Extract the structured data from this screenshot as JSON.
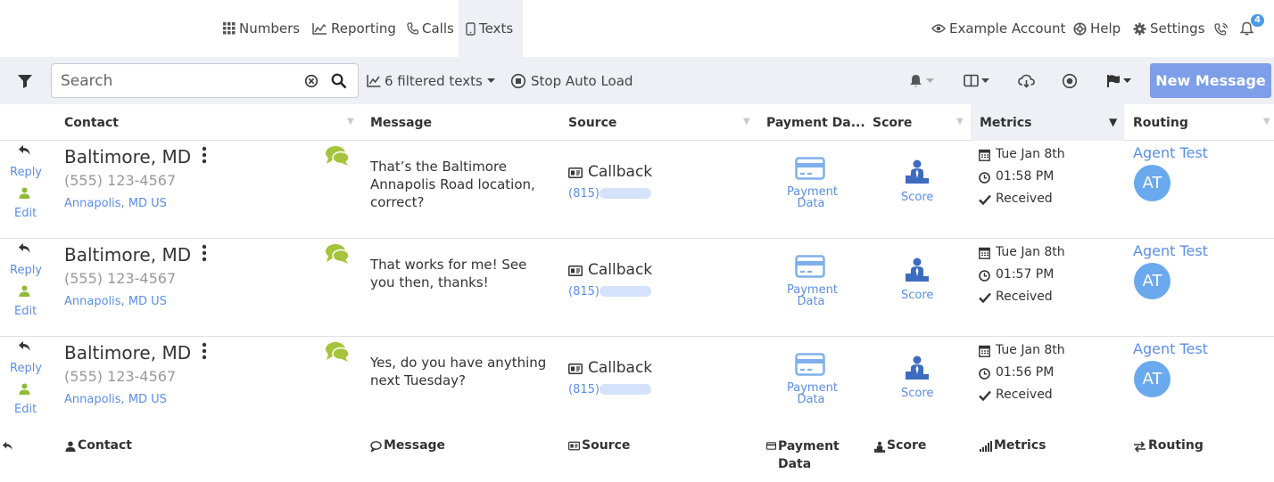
{
  "nav": {
    "items": [
      {
        "label": "Numbers",
        "icon": "grid-icon"
      },
      {
        "label": "Reporting",
        "icon": "chart-icon"
      },
      {
        "label": "Calls",
        "icon": "phone-icon"
      },
      {
        "label": "Texts",
        "icon": "mobile-icon",
        "active": true
      }
    ],
    "right": {
      "account": "Example Account",
      "help": "Help",
      "settings": "Settings",
      "notification_count": "4"
    }
  },
  "toolbar": {
    "search_placeholder": "Search",
    "filtered": "6 filtered texts",
    "stop_auto_load": "Stop Auto Load",
    "new_message": "New Message"
  },
  "columns": {
    "contact": "Contact",
    "message": "Message",
    "source": "Source",
    "payment": "Payment Da...",
    "score": "Score",
    "metrics": "Metrics",
    "routing": "Routing"
  },
  "rows": [
    {
      "reply": "Reply",
      "edit": "Edit",
      "city": "Baltimore, MD",
      "phone": "(555) 123-4567",
      "loc_city": "Annapolis",
      "loc_state": "MD US",
      "message": "That’s the Baltimore Annapolis Road location, correct?",
      "source_type": "Callback",
      "source_area": "(815)",
      "payment": "Payment Data",
      "score": "Score",
      "date": "Tue Jan 8th",
      "time": "01:58 PM",
      "status": "Received",
      "agent": "Agent Test",
      "initials": "AT"
    },
    {
      "reply": "Reply",
      "edit": "Edit",
      "city": "Baltimore, MD",
      "phone": "(555) 123-4567",
      "loc_city": "Annapolis",
      "loc_state": "MD US",
      "message": "That works for me! See you then, thanks!",
      "source_type": "Callback",
      "source_area": "(815)",
      "payment": "Payment Data",
      "score": "Score",
      "date": "Tue Jan 8th",
      "time": "01:57 PM",
      "status": "Received",
      "agent": "Agent Test",
      "initials": "AT"
    },
    {
      "reply": "Reply",
      "edit": "Edit",
      "city": "Baltimore, MD",
      "phone": "(555) 123-4567",
      "loc_city": "Annapolis",
      "loc_state": "MD US",
      "message": "Yes, do you have anything next Tuesday?",
      "source_type": "Callback",
      "source_area": "(815)",
      "payment": "Payment Data",
      "score": "Score",
      "date": "Tue Jan 8th",
      "time": "01:56 PM",
      "status": "Received",
      "agent": "Agent Test",
      "initials": "AT"
    }
  ],
  "footer": {
    "contact": "Contact",
    "message": "Message",
    "source": "Source",
    "payment": "Payment Data",
    "score": "Score",
    "metrics": "Metrics",
    "routing": "Routing"
  },
  "colors": {
    "link": "#5a8ee8",
    "primary_button": "#7d9ee8",
    "toolbar_bg": "#eef0f5",
    "chat_icon": "#a4c43b",
    "user_icon": "#8fba3a",
    "avatar": "#6aa9ee"
  }
}
